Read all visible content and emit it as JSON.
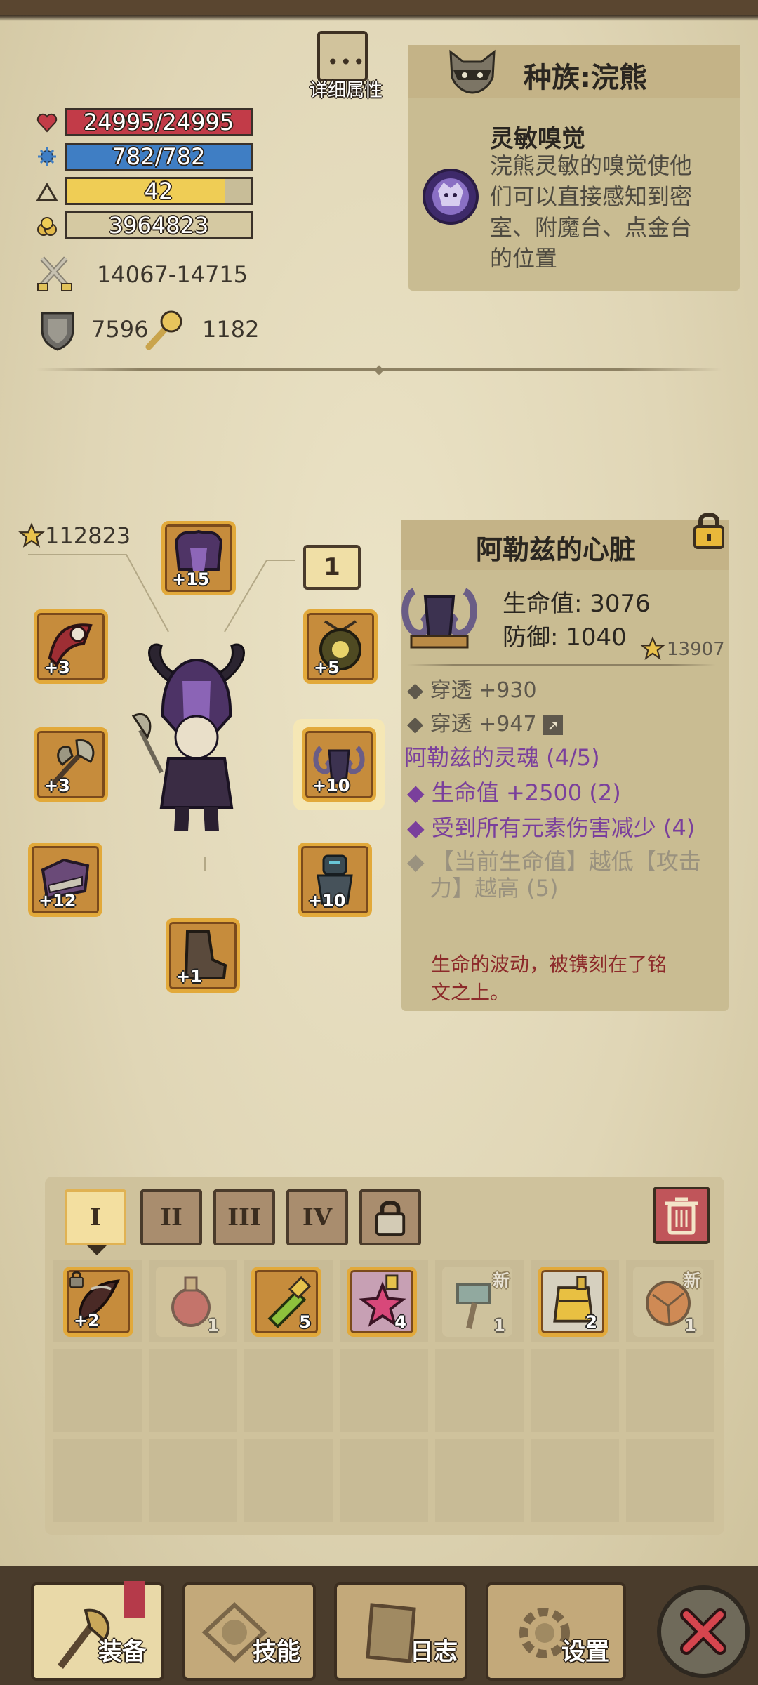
{
  "detail_button": {
    "label": "详细属性"
  },
  "stats": {
    "hp": "24995/24995",
    "mana": "782/782",
    "level": "42",
    "gold": "3964823",
    "attack": "14067-14715",
    "defense": "7596",
    "magic": "1182"
  },
  "race": {
    "title": "种族:浣熊",
    "trait_name": "灵敏嗅觉",
    "trait_desc": "浣熊灵敏的嗅觉使他们可以直接感知到密室、附魔台、点金台的位置"
  },
  "equipment": {
    "total_score": "112823",
    "slots": [
      {
        "name": "helmet",
        "level": "+15"
      },
      {
        "name": "left-top",
        "level": "+3"
      },
      {
        "name": "weapon",
        "level": "+3"
      },
      {
        "name": "armor",
        "level": "+12"
      },
      {
        "name": "boots",
        "level": "+1"
      },
      {
        "name": "amulet",
        "level": "+5"
      },
      {
        "name": "heart",
        "level": "+10"
      },
      {
        "name": "relic",
        "level": "+10"
      }
    ],
    "page_badge": "1"
  },
  "item_detail": {
    "name": "阿勒兹的心脏",
    "hp_stat": "生命值: 3076",
    "def_stat": "防御: 1040",
    "score": "13907",
    "bonus1": "穿透 +930",
    "bonus2": "穿透 +947",
    "set_name": "阿勒兹的灵魂 (4/5)",
    "set1": "生命值 +2500 (2)",
    "set2": "受到所有元素伤害减少 (4)",
    "set3a": "【当前生命值】越低【攻击",
    "set3b": "力】越高 (5)",
    "flavor_a": "生命的波动，被镌刻在了铭",
    "flavor_b": "文之上。"
  },
  "tabs": [
    "I",
    "II",
    "III",
    "IV"
  ],
  "inventory": [
    {
      "name": "dark-bow",
      "count": "+2"
    },
    {
      "name": "red-potion",
      "count": "1"
    },
    {
      "name": "green-potion",
      "count": "5"
    },
    {
      "name": "pink-star-potion",
      "count": "4"
    },
    {
      "name": "hammer",
      "count": "1",
      "badge": "新"
    },
    {
      "name": "gold-armor",
      "count": "2"
    },
    {
      "name": "orange-orb",
      "count": "1",
      "badge": "新"
    }
  ],
  "nav": {
    "equip": "装备",
    "skills": "技能",
    "log": "日志",
    "settings": "设置"
  },
  "colors": {
    "hp": "#c23b48",
    "mana": "#3f7ec4",
    "exp": "#efcd55",
    "panel": "#c9bc92",
    "set": "#7a3f9c"
  }
}
